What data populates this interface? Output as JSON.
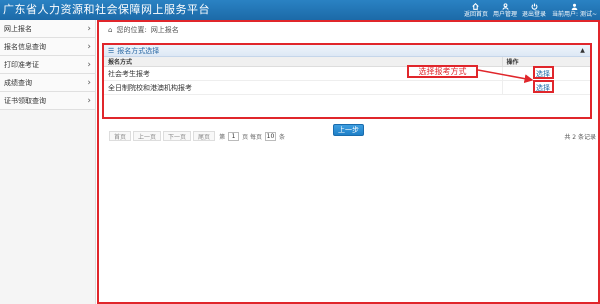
{
  "app": {
    "title": "广东省人力资源和社会保障网上服务平台"
  },
  "header_nav": [
    {
      "label": "返回首页",
      "icon": "home-icon"
    },
    {
      "label": "用户管理",
      "icon": "user-icon"
    },
    {
      "label": "退出登录",
      "icon": "power-icon"
    }
  ],
  "header_user": {
    "label": "当前用户: 测试~"
  },
  "sidebar": {
    "items": [
      {
        "label": "网上报名"
      },
      {
        "label": "报名信息查询"
      },
      {
        "label": "打印准考证"
      },
      {
        "label": "成绩查询"
      },
      {
        "label": "证书领取查询"
      }
    ]
  },
  "breadcrumb": {
    "prefix": "您的位置:",
    "current": "网上报名"
  },
  "panel": {
    "title": "报名方式选择"
  },
  "table": {
    "columns": [
      "报名方式",
      "操作"
    ],
    "rows": [
      {
        "method": "社会考生报考",
        "action": "选择"
      },
      {
        "method": "全日制院校和港澳机构报考",
        "action": "选择"
      }
    ]
  },
  "annotation": {
    "text": "选择报考方式"
  },
  "pager": {
    "first": "首页",
    "prev": "上一页",
    "next": "下一页",
    "last": "尾页",
    "page_prefix": "第",
    "page_value": "1",
    "page_suffix": "页 每页",
    "per_page": "10",
    "per_page_suffix": "条",
    "total": "共 2 条记录"
  },
  "buttons": {
    "prev_step": "上一步"
  },
  "colors": {
    "header": "#1c6aa8",
    "highlight": "#e0262b",
    "link": "#1c6aa8"
  }
}
